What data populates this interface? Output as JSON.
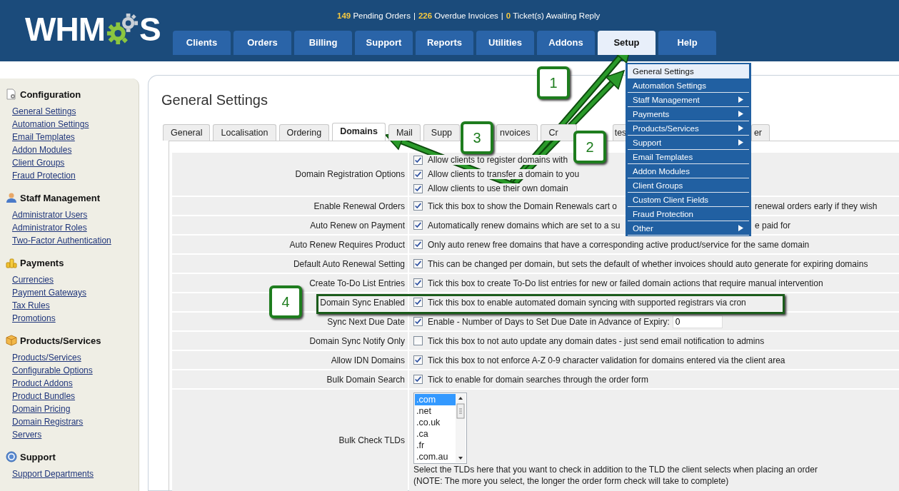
{
  "logo": {
    "left": "WHM",
    "right": "S"
  },
  "stats": [
    {
      "count": "149",
      "label": "Pending Orders"
    },
    {
      "count": "226",
      "label": "Overdue Invoices"
    },
    {
      "count": "0",
      "label": "Ticket(s) Awaiting Reply"
    }
  ],
  "stats_separator": "|",
  "nav": [
    {
      "label": "Clients",
      "selected": false
    },
    {
      "label": "Orders",
      "selected": false
    },
    {
      "label": "Billing",
      "selected": false
    },
    {
      "label": "Support",
      "selected": false
    },
    {
      "label": "Reports",
      "selected": false
    },
    {
      "label": "Utilities",
      "selected": false
    },
    {
      "label": "Addons",
      "selected": false
    },
    {
      "label": "Setup",
      "selected": true
    },
    {
      "label": "Help",
      "selected": false
    }
  ],
  "setup_menu": [
    {
      "label": "General Settings",
      "selected": true,
      "submenu": false
    },
    {
      "label": "Automation Settings",
      "selected": false,
      "submenu": false
    },
    {
      "label": "Staff Management",
      "selected": false,
      "submenu": true
    },
    {
      "label": "Payments",
      "selected": false,
      "submenu": true
    },
    {
      "label": "Products/Services",
      "selected": false,
      "submenu": true
    },
    {
      "label": "Support",
      "selected": false,
      "submenu": true
    },
    {
      "label": "Email Templates",
      "selected": false,
      "submenu": false
    },
    {
      "label": "Addon Modules",
      "selected": false,
      "submenu": false
    },
    {
      "label": "Client Groups",
      "selected": false,
      "submenu": false
    },
    {
      "label": "Custom Client Fields",
      "selected": false,
      "submenu": false
    },
    {
      "label": "Fraud Protection",
      "selected": false,
      "submenu": false
    },
    {
      "label": "Other",
      "selected": false,
      "submenu": true
    }
  ],
  "sidebar": [
    {
      "heading": "Configuration",
      "links": [
        "General Settings",
        "Automation Settings",
        "Email Templates",
        "Addon Modules",
        "Client Groups",
        "Fraud Protection"
      ]
    },
    {
      "heading": "Staff Management",
      "links": [
        "Administrator Users",
        "Administrator Roles",
        "Two-Factor Authentication"
      ]
    },
    {
      "heading": "Payments",
      "links": [
        "Currencies",
        "Payment Gateways",
        "Tax Rules",
        "Promotions"
      ]
    },
    {
      "heading": "Products/Services",
      "links": [
        "Products/Services",
        "Configurable Options",
        "Product Addons",
        "Product Bundles",
        "Domain Pricing",
        "Domain Registrars",
        "Servers"
      ]
    },
    {
      "heading": "Support",
      "links": [
        "Support Departments"
      ]
    }
  ],
  "page_title": "General Settings",
  "tabs": [
    {
      "label": "General",
      "selected": false
    },
    {
      "label": "Localisation",
      "selected": false
    },
    {
      "label": "Ordering",
      "selected": false
    },
    {
      "label": "Domains",
      "selected": true
    },
    {
      "label": "Mail",
      "selected": false
    },
    {
      "label": "Supp",
      "selected": false
    },
    {
      "label": "nvoices",
      "selected": false
    },
    {
      "label": "Cr",
      "selected": false
    },
    {
      "label": "tes",
      "selected": false
    },
    {
      "label": "er",
      "selected": false
    }
  ],
  "rows": [
    {
      "kind": "options",
      "label": "Domain Registration Options",
      "options": [
        {
          "checked": true,
          "text": "Allow clients to register domains with"
        },
        {
          "checked": true,
          "text": "Allow clients to transfer a domain to you"
        },
        {
          "checked": true,
          "text": "Allow clients to use their own domain"
        }
      ]
    },
    {
      "kind": "check",
      "label": "Enable Renewal Orders",
      "checked": true,
      "text": "Tick this box to show the Domain Renewals cart o",
      "text_after": "renewal orders early if they wish"
    },
    {
      "kind": "check",
      "label": "Auto Renew on Payment",
      "checked": true,
      "text": "Automatically renew domains which are set to a su",
      "text_after": "e paid for"
    },
    {
      "kind": "check",
      "label": "Auto Renew Requires Product",
      "checked": true,
      "text": "Only auto renew free domains that have a corresponding active product/service for the same domain"
    },
    {
      "kind": "check",
      "label": "Default Auto Renewal Setting",
      "checked": true,
      "text": "This can be changed per domain, but sets the default of whether invoices should auto generate for expiring domains"
    },
    {
      "kind": "check",
      "label": "Create To-Do List Entries",
      "checked": true,
      "text": "Tick this box to create To-Do list entries for new or failed domain actions that require manual intervention"
    },
    {
      "kind": "check",
      "label": "Domain Sync Enabled",
      "checked": true,
      "text": "Tick this box to enable automated domain syncing with supported registrars via cron"
    },
    {
      "kind": "days",
      "label": "Sync Next Due Date",
      "checked": true,
      "text": "Enable - Number of Days to Set Due Date in Advance of Expiry:",
      "value": "0"
    },
    {
      "kind": "check",
      "label": "Domain Sync Notify Only",
      "checked": false,
      "text": "Tick this box to not auto update any domain dates - just send email notification to admins"
    },
    {
      "kind": "check",
      "label": "Allow IDN Domains",
      "checked": true,
      "text": "Tick this box to not enforce A-Z 0-9 character validation for domains entered via the client area"
    },
    {
      "kind": "check",
      "label": "Bulk Domain Search",
      "checked": true,
      "text": "Tick to enable for domain searches through the order form"
    },
    {
      "kind": "tlds",
      "label": "Bulk Check TLDs",
      "options": [
        {
          "text": ".com",
          "selected": true
        },
        {
          "text": ".net",
          "selected": false
        },
        {
          "text": ".co.uk",
          "selected": false
        },
        {
          "text": ".ca",
          "selected": false
        },
        {
          "text": ".fr",
          "selected": false
        },
        {
          "text": ".com.au",
          "selected": false
        }
      ],
      "note": [
        "Select the TLDs here that you want to check in addition to the TLD the client selects when placing an order",
        "(NOTE: The more you select, the longer the order form check will take to complete)"
      ]
    }
  ],
  "callouts": [
    "1",
    "2",
    "3",
    "4"
  ]
}
